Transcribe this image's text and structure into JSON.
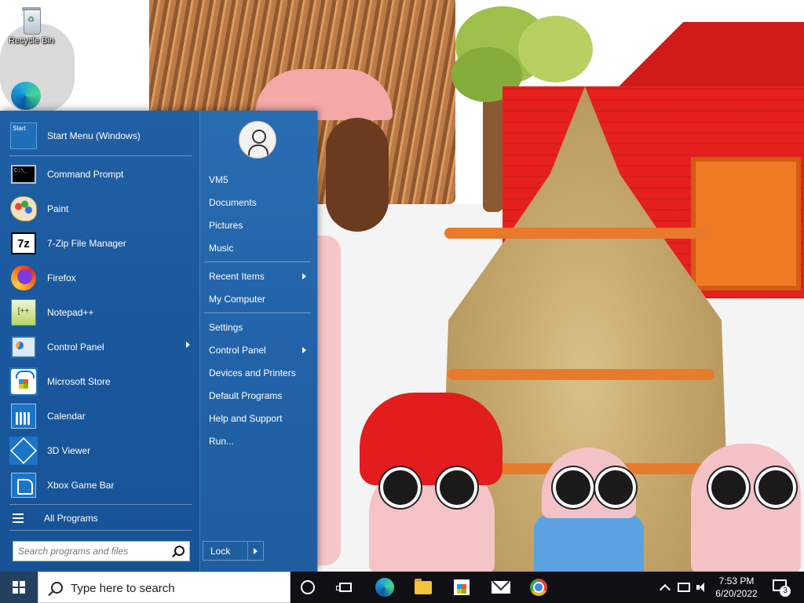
{
  "desktop": {
    "icons": [
      {
        "label": "Recycle Bin",
        "icon": "recycle-bin-icon"
      }
    ]
  },
  "start_menu": {
    "programs": [
      {
        "label": "Start Menu (Windows)",
        "icon": "start-menu-icon",
        "has_submenu": false
      },
      {
        "label": "Command Prompt",
        "icon": "command-prompt-icon",
        "has_submenu": false
      },
      {
        "label": "Paint",
        "icon": "paint-icon",
        "has_submenu": false
      },
      {
        "label": "7-Zip File Manager",
        "icon": "7zip-icon",
        "has_submenu": false
      },
      {
        "label": "Firefox",
        "icon": "firefox-icon",
        "has_submenu": false
      },
      {
        "label": "Notepad++",
        "icon": "notepad-plus-plus-icon",
        "has_submenu": false
      },
      {
        "label": "Control Panel",
        "icon": "control-panel-icon",
        "has_submenu": true
      },
      {
        "label": "Microsoft Store",
        "icon": "microsoft-store-icon",
        "has_submenu": false
      },
      {
        "label": "Calendar",
        "icon": "calendar-icon",
        "has_submenu": false
      },
      {
        "label": "3D Viewer",
        "icon": "3d-viewer-icon",
        "has_submenu": false
      },
      {
        "label": "Xbox Game Bar",
        "icon": "xbox-game-bar-icon",
        "has_submenu": false
      }
    ],
    "all_programs": "All Programs",
    "search_placeholder": "Search programs and files",
    "start_tile_text": "Start",
    "cmd_tile_text": "C:\\_",
    "sevenzip_tile_text": "7z",
    "npp_tile_text": "[++",
    "user": {
      "name": "VM5",
      "icon": "user-avatar-icon"
    },
    "right_items": [
      {
        "label": "Documents",
        "has_submenu": false
      },
      {
        "label": "Pictures",
        "has_submenu": false
      },
      {
        "label": "Music",
        "has_submenu": false
      },
      {
        "label": "Recent Items",
        "has_submenu": true
      },
      {
        "label": "My Computer",
        "has_submenu": false
      },
      {
        "label": "Settings",
        "has_submenu": false
      },
      {
        "label": "Control Panel",
        "has_submenu": true
      },
      {
        "label": "Devices and Printers",
        "has_submenu": false
      },
      {
        "label": "Default Programs",
        "has_submenu": false
      },
      {
        "label": "Help and Support",
        "has_submenu": false
      },
      {
        "label": "Run...",
        "has_submenu": false
      }
    ],
    "lock_label": "Lock"
  },
  "taskbar": {
    "search_placeholder": "Type here to search",
    "pinned": [
      {
        "name": "cortana",
        "icon": "cortana-circle-icon"
      },
      {
        "name": "task-view",
        "icon": "task-view-icon"
      },
      {
        "name": "edge",
        "icon": "edge-icon"
      },
      {
        "name": "file-explorer",
        "icon": "folder-icon"
      },
      {
        "name": "microsoft-store",
        "icon": "store-bag-icon"
      },
      {
        "name": "mail",
        "icon": "mail-icon"
      },
      {
        "name": "chrome",
        "icon": "chrome-icon"
      }
    ],
    "clock": {
      "time": "7:53 PM",
      "date": "6/20/2022"
    },
    "notification_count": "3"
  },
  "colors": {
    "start_menu_blue": "#1f5fa3",
    "taskbar": "#101014",
    "start_button": "#24405f"
  }
}
